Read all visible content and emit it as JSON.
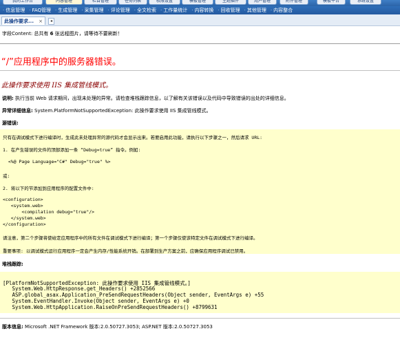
{
  "top_tabs": [
    "我的工作台",
    "内容管理",
    "栏目管理",
    "任务列表",
    "权限设置",
    "模板管理",
    "主题插件",
    "用户管理",
    "附件管理",
    "模板平台",
    "系统设置"
  ],
  "subnav": [
    "信息管理",
    "FAQ管理",
    "生成管理",
    "采集管理",
    "评论管理",
    "全文检索",
    "工作量统计",
    "内容转换",
    "回收管理",
    "其他管理",
    "内容整合"
  ],
  "doc_tab": {
    "label": "此操作要求...",
    "close": "×",
    "menu": "◂"
  },
  "notice": {
    "prefix": "字段Content: 总共有 ",
    "count": "6",
    "suffix": " 张远程图片，请等待不要刷新！"
  },
  "error": {
    "title": "“/”应用程序中的服务器错误。",
    "subtitle": "此操作要求使用 IIS 集成管线模式。",
    "desc_label": "说明:",
    "desc_text": " 执行当前 Web 请求期间，出现未处理的异常。请检查堆栈跟踪信息，以了解有关该错误以及代码中导致错误的出处的详细信息。",
    "detail_label": "异常详细信息:",
    "detail_text": " System.PlatformNotSupportedException: 此操作要求使用 IIS 集成管线模式。",
    "source_label": "源错误:",
    "source_lines": [
      "只有在调试模式下进行编译时，生成此未处理异常的源代码才会显示出来。若要启用此功能，请执行以下步骤之一，然后请求 URL:",
      "1. 在产生错误的文件的顶部添加一条 “Debug=true” 指令。例如:",
      "  <%@ Page Language=\"C#\" Debug=\"true\" %>",
      "或:",
      "2. 将以下的节添加到应用程序的配置文件中:",
      "<configuration>",
      "   <system.web>",
      "       <compilation debug=\"true\"/>",
      "   </system.web>",
      "</configuration>",
      "请注意，第二个步骤将使给定应用程序中的所有文件在调试模式下进行编译；第一个步骤仅使该特定文件在调试模式下进行编译。",
      "重要事项: 以调试模式运行应用程序一定会产生内存/性能系统开销。在部署到生产方案之前，应确保应用程序调试已禁用。"
    ],
    "stack_label": "堆栈跟踪:",
    "stack_lines": [
      "[PlatformNotSupportedException: 此操作要求使用 IIS 集成管线模式。]",
      "   System.Web.HttpResponse.get_Headers() +2852566",
      "   ASP.global_asax.Application_PreSendRequestHeaders(Object sender, EventArgs e) +55",
      "   System.EventHandler.Invoke(Object sender, EventArgs e) +0",
      "   System.Web.HttpApplication.RaiseOnPreSendRequestHeaders() +8799631"
    ],
    "version_label": "版本信息:",
    "version_text": " Microsoft .NET Framework 版本:2.0.50727.3053; ASP.NET 版本:2.0.50727.3053"
  }
}
